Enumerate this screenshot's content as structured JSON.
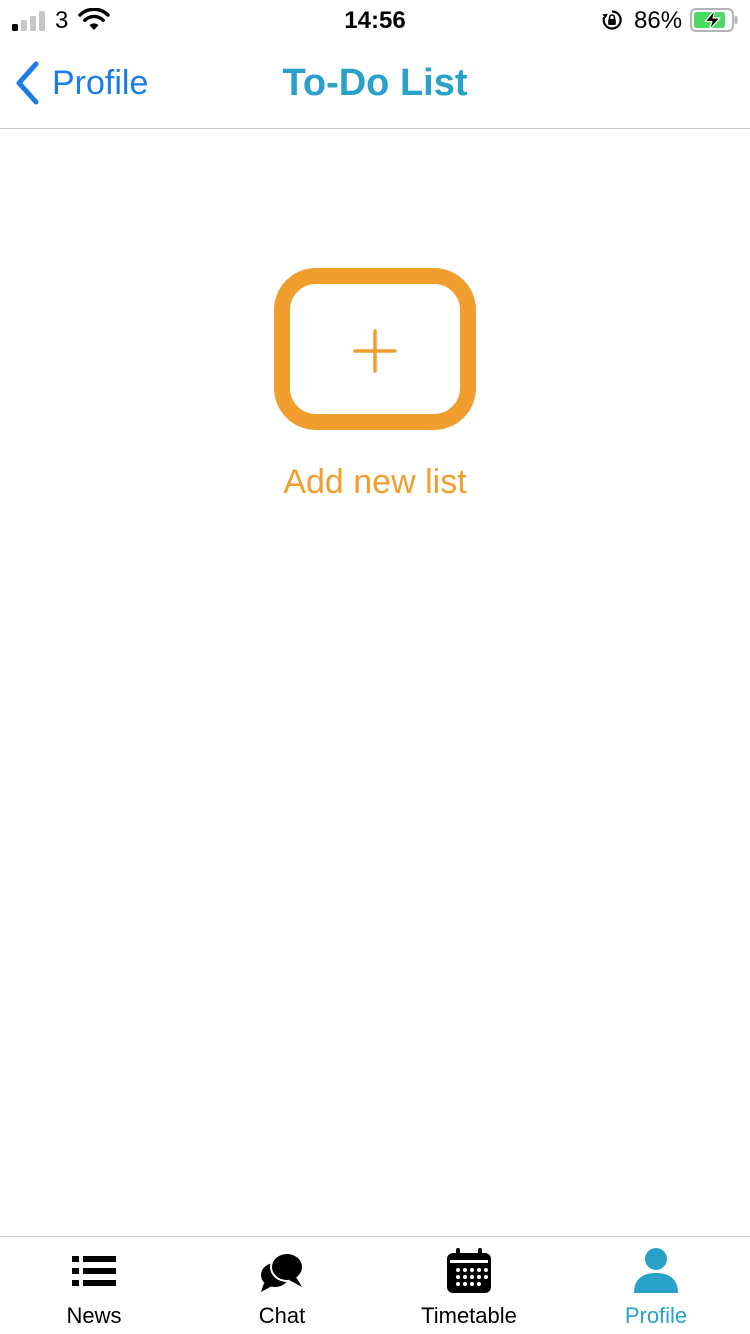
{
  "status_bar": {
    "carrier": "3",
    "time": "14:56",
    "battery_percent": "86%",
    "signal_bars_active": 1,
    "signal_bars_total": 4,
    "battery_level": 0.86,
    "battery_charging": true
  },
  "nav": {
    "back_label": "Profile",
    "title": "To-Do List"
  },
  "main": {
    "add_label": "Add new list"
  },
  "tab_bar": {
    "items": [
      {
        "label": "News",
        "icon": "list-icon",
        "active": false
      },
      {
        "label": "Chat",
        "icon": "chat-bubbles-icon",
        "active": false
      },
      {
        "label": "Timetable",
        "icon": "calendar-icon",
        "active": false
      },
      {
        "label": "Profile",
        "icon": "person-icon",
        "active": true
      }
    ]
  },
  "colors": {
    "accent_blue": "#2aa1c9",
    "link_blue": "#1a7ee6",
    "orange": "#f09e2e",
    "battery_green": "#4cd964"
  }
}
